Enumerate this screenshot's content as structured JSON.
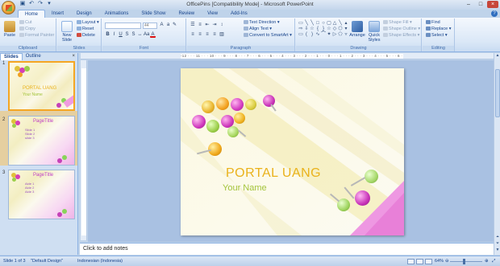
{
  "window": {
    "title": "OfficePins [Compatibility Mode] - Microsoft PowerPoint"
  },
  "tabs": [
    "Home",
    "Insert",
    "Design",
    "Animations",
    "Slide Show",
    "Review",
    "View",
    "Add-Ins"
  ],
  "ribbon": {
    "clipboard": {
      "label": "Clipboard",
      "paste": "Paste",
      "cut": "Cut",
      "copy": "Copy",
      "format_painter": "Format Painter"
    },
    "slides": {
      "label": "Slides",
      "new_slide": "New Slide",
      "layout": "Layout",
      "reset": "Reset",
      "delete": "Delete"
    },
    "font": {
      "label": "Font",
      "font_size": "44"
    },
    "paragraph": {
      "label": "Paragraph",
      "text_direction": "Text Direction",
      "align_text": "Align Text",
      "convert_smartart": "Convert to SmartArt"
    },
    "drawing": {
      "label": "Drawing",
      "arrange": "Arrange",
      "quick_styles": "Quick Styles",
      "shape_fill": "Shape Fill",
      "shape_outline": "Shape Outline",
      "shape_effects": "Shape Effects"
    },
    "editing": {
      "label": "Editing",
      "find": "Find",
      "replace": "Replace",
      "select": "Select"
    }
  },
  "panel": {
    "tabs": [
      "Slides",
      "Outline"
    ],
    "thumbnails": [
      {
        "num": "1",
        "title": "PORTAL UANG",
        "subtitle": "Your Name"
      },
      {
        "num": "2",
        "title": "PageTitle",
        "bullets": [
          "Slide 1",
          "Slide 2",
          "slide 3"
        ]
      },
      {
        "num": "3",
        "title": "PageTitle",
        "bullets": [
          "Aide 1",
          "Aide 2",
          "Aide 3"
        ]
      }
    ]
  },
  "ruler": {
    "ticks": "-12 · · · 11 · · · 10 · · · 9 · · · 8 · · · 7 · · · 6 · · · 5 · · · 4 · · · 3 · · · 2 · · · 1 · · · 0 · · · 1 · · · 2 · · · 3 · · · 4 · · · 5 · · · 6 · · · 7 · · · 8 · · · 9 · · · 10 · · · 11 · · · 12"
  },
  "slide": {
    "title": "PORTAL UANG",
    "subtitle": "Your Name"
  },
  "notes": {
    "placeholder": "Click to add notes"
  },
  "status": {
    "slide_info": "Slide 1 of 3",
    "theme": "\"Default Design\"",
    "language": "Indonesian (Indonesia)",
    "zoom": "64%"
  },
  "colors": {
    "accent_orange": "#f5a623",
    "title_gold": "#eab21b",
    "subtitle_green": "#a4c43b",
    "ribbon_blue": "#15428b"
  }
}
